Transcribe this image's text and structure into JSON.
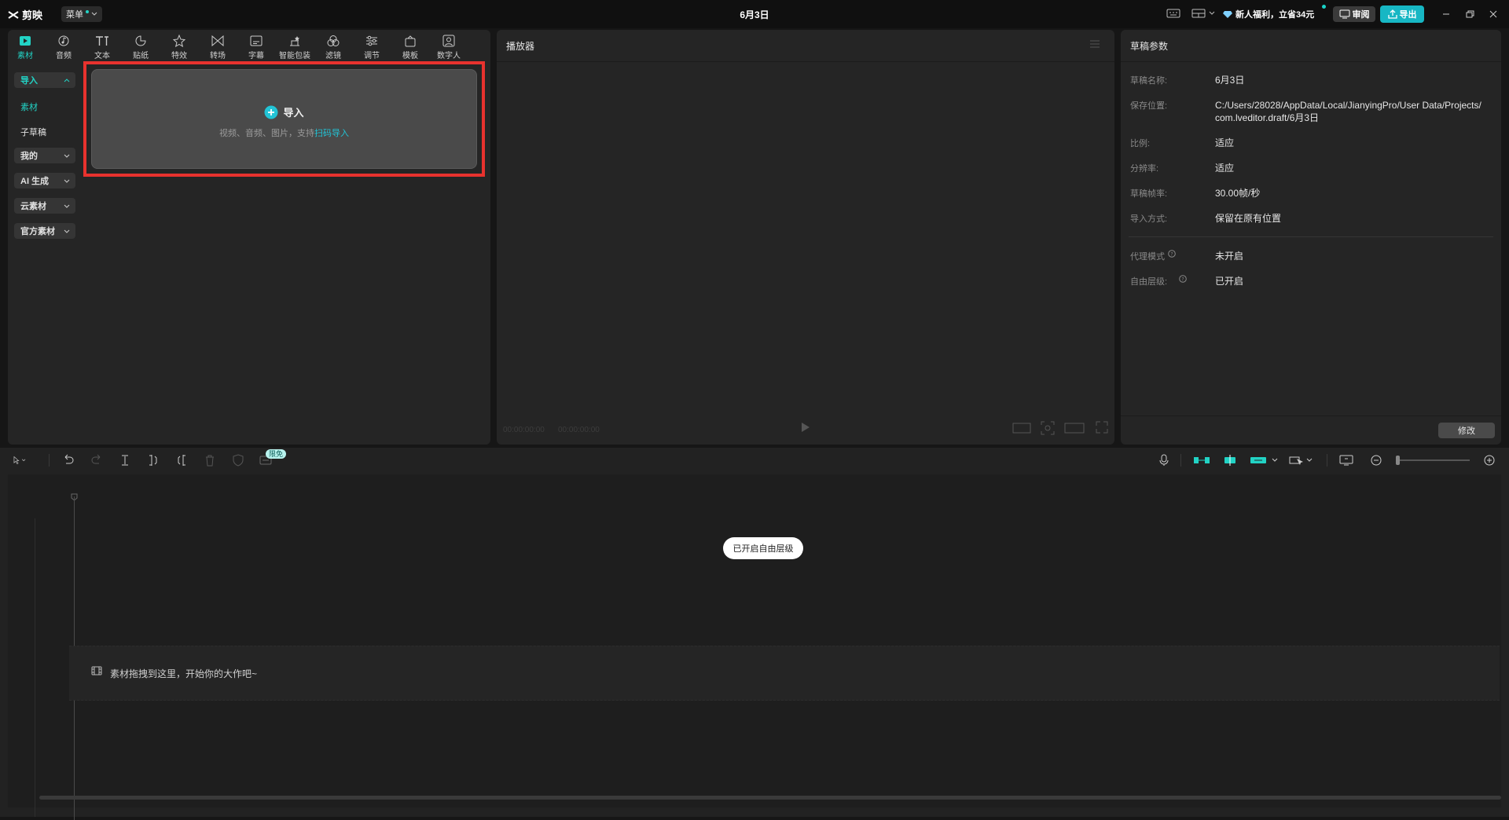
{
  "app": {
    "name": "剪映",
    "title": "6月3日"
  },
  "titlebar": {
    "menu_label": "菜单",
    "promo_text": "新人福利，立省34元",
    "review_label": "审阅",
    "export_label": "导出"
  },
  "tool_tabs": [
    {
      "label": "素材",
      "icon": "media-icon"
    },
    {
      "label": "音频",
      "icon": "audio-icon"
    },
    {
      "label": "文本",
      "icon": "text-icon"
    },
    {
      "label": "贴纸",
      "icon": "sticker-icon"
    },
    {
      "label": "特效",
      "icon": "effects-icon"
    },
    {
      "label": "转场",
      "icon": "transition-icon"
    },
    {
      "label": "字幕",
      "icon": "subtitle-icon"
    },
    {
      "label": "智能包装",
      "icon": "smart-pack-icon"
    },
    {
      "label": "滤镜",
      "icon": "filter-icon"
    },
    {
      "label": "调节",
      "icon": "adjust-icon"
    },
    {
      "label": "模板",
      "icon": "template-icon"
    },
    {
      "label": "数字人",
      "icon": "digital-human-icon"
    }
  ],
  "sidebar": {
    "import": "导入",
    "material": "素材",
    "sub_draft": "子草稿",
    "mine": "我的",
    "ai_gen": "AI 生成",
    "cloud": "云素材",
    "official": "官方素材"
  },
  "import_card": {
    "title": "导入",
    "subtitle_prefix": "视频、音频、图片，支持",
    "subtitle_link": "扫码导入"
  },
  "player": {
    "title": "播放器",
    "time_current": "00:00:00:00",
    "time_total": "00:00:00:00"
  },
  "props": {
    "title": "草稿参数",
    "rows": [
      {
        "label": "草稿名称:",
        "value": "6月3日"
      },
      {
        "label": "保存位置:",
        "value": "C:/Users/28028/AppData/Local/JianyingPro/User Data/Projects/com.lveditor.draft/6月3日"
      },
      {
        "label": "比例:",
        "value": "适应"
      },
      {
        "label": "分辨率:",
        "value": "适应"
      },
      {
        "label": "草稿帧率:",
        "value": "30.00帧/秒"
      },
      {
        "label": "导入方式:",
        "value": "保留在原有位置"
      },
      {
        "label": "代理模式",
        "value": "未开启"
      },
      {
        "label": "自由层级:",
        "value": "已开启"
      }
    ],
    "modify_label": "修改"
  },
  "timeline": {
    "limited_badge": "限免",
    "free_layer_pill": "已开启自由层级",
    "drop_hint": "素材拖拽到这里，开始你的大作吧~"
  },
  "colors": {
    "accent": "#22d3c5",
    "highlight": "#e8322e",
    "export": "#17b7c4"
  }
}
